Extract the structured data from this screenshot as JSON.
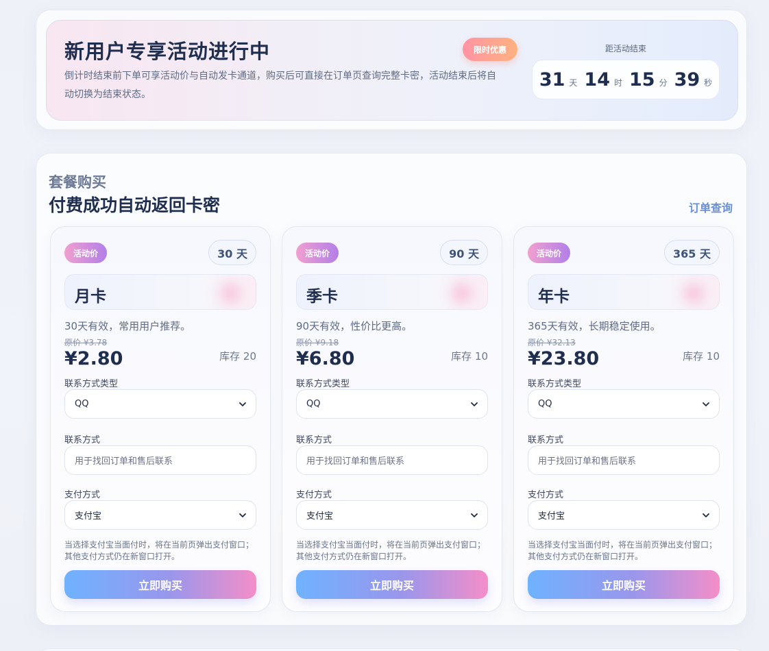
{
  "promo": {
    "title": "新用户专享活动进行中",
    "description": "倒计时结束前下单可享活动价与自动发卡通道，购买后可直接在订单页查询完整卡密，活动结束后将自动切换为结束状态。",
    "badge": "限时优惠",
    "countdown": {
      "label": "距活动结束",
      "days": "31",
      "days_unit": "天",
      "hours": "14",
      "hours_unit": "时",
      "minutes": "15",
      "minutes_unit": "分",
      "seconds": "39",
      "seconds_unit": "秒"
    }
  },
  "plans_section": {
    "kicker": "套餐购买",
    "title": "付费成功自动返回卡密",
    "order_link": "订单查询",
    "plans": [
      {
        "tag": "活动价",
        "days": "30 天",
        "name": "月卡",
        "description": "30天有效，常用用户推荐。",
        "original_price": "原价 ¥3.78",
        "price": "¥2.80",
        "stock": "库存 20",
        "contact_type_label": "联系方式类型",
        "contact_type_value": "QQ",
        "contact_label": "联系方式",
        "contact_placeholder": "用于找回订单和售后联系",
        "payment_label": "支付方式",
        "payment_value": "支付宝",
        "note": "当选择支付宝当面付时，将在当前页弹出支付窗口；其他支付方式仍在新窗口打开。",
        "buy_label": "立即购买"
      },
      {
        "tag": "活动价",
        "days": "90 天",
        "name": "季卡",
        "description": "90天有效，性价比更高。",
        "original_price": "原价 ¥9.18",
        "price": "¥6.80",
        "stock": "库存 10",
        "contact_type_label": "联系方式类型",
        "contact_type_value": "QQ",
        "contact_label": "联系方式",
        "contact_placeholder": "用于找回订单和售后联系",
        "payment_label": "支付方式",
        "payment_value": "支付宝",
        "note": "当选择支付宝当面付时，将在当前页弹出支付窗口；其他支付方式仍在新窗口打开。",
        "buy_label": "立即购买"
      },
      {
        "tag": "活动价",
        "days": "365 天",
        "name": "年卡",
        "description": "365天有效，长期稳定使用。",
        "original_price": "原价 ¥32.13",
        "price": "¥23.80",
        "stock": "库存 10",
        "contact_type_label": "联系方式类型",
        "contact_type_value": "QQ",
        "contact_label": "联系方式",
        "contact_placeholder": "用于找回订单和售后联系",
        "payment_label": "支付方式",
        "payment_value": "支付宝",
        "note": "当选择支付宝当面付时，将在当前页弹出支付窗口；其他支付方式仍在新窗口打开。",
        "buy_label": "立即购买"
      }
    ]
  }
}
